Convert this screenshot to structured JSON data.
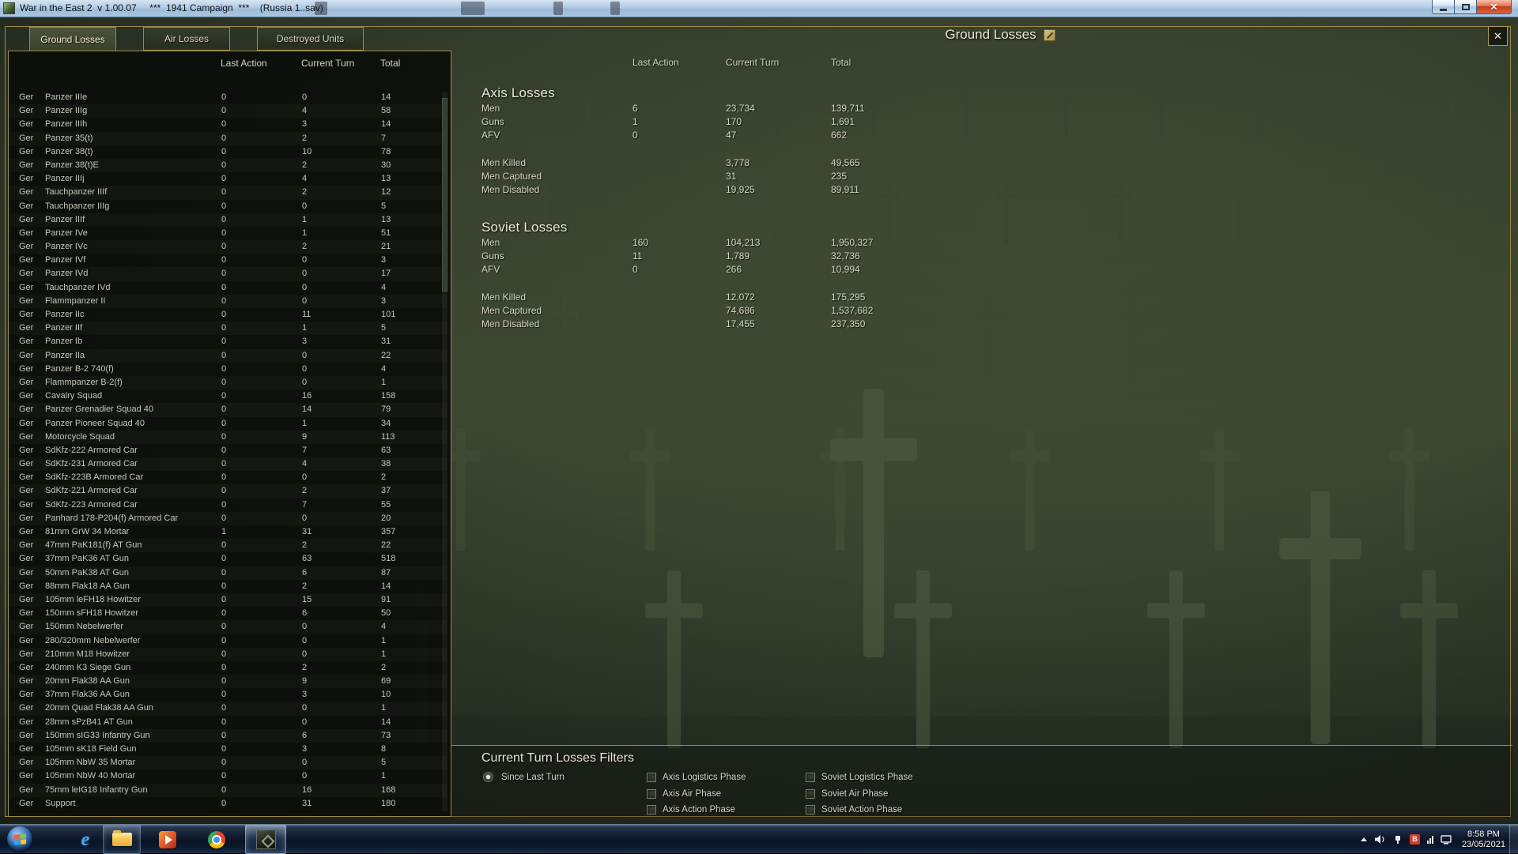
{
  "window": {
    "title": "War in the East 2  v 1.00.07     ***  1941 Campaign  ***    (Russia 1..sav)",
    "close_glyph": "✕"
  },
  "screen": {
    "title": "Ground Losses",
    "tabs": [
      {
        "label": "Ground Losses",
        "active": true
      },
      {
        "label": "Air Losses",
        "active": false
      },
      {
        "label": "Destroyed Units",
        "active": false
      }
    ]
  },
  "left_table": {
    "headers": {
      "last_action": "Last Action",
      "current_turn": "Current Turn",
      "total": "Total"
    },
    "rows": [
      {
        "nat": "Ger",
        "name": "Panzer IIIe",
        "last_action": "0",
        "current_turn": "0",
        "total": "14"
      },
      {
        "nat": "Ger",
        "name": "Panzer IIIg",
        "last_action": "0",
        "current_turn": "4",
        "total": "58"
      },
      {
        "nat": "Ger",
        "name": "Panzer IIIh",
        "last_action": "0",
        "current_turn": "3",
        "total": "14"
      },
      {
        "nat": "Ger",
        "name": "Panzer 35(t)",
        "last_action": "0",
        "current_turn": "2",
        "total": "7"
      },
      {
        "nat": "Ger",
        "name": "Panzer 38(t)",
        "last_action": "0",
        "current_turn": "10",
        "total": "78"
      },
      {
        "nat": "Ger",
        "name": "Panzer 38(t)E",
        "last_action": "0",
        "current_turn": "2",
        "total": "30"
      },
      {
        "nat": "Ger",
        "name": "Panzer IIIj",
        "last_action": "0",
        "current_turn": "4",
        "total": "13"
      },
      {
        "nat": "Ger",
        "name": "Tauchpanzer IIIf",
        "last_action": "0",
        "current_turn": "2",
        "total": "12"
      },
      {
        "nat": "Ger",
        "name": "Tauchpanzer IIIg",
        "last_action": "0",
        "current_turn": "0",
        "total": "5"
      },
      {
        "nat": "Ger",
        "name": "Panzer IIIf",
        "last_action": "0",
        "current_turn": "1",
        "total": "13"
      },
      {
        "nat": "Ger",
        "name": "Panzer IVe",
        "last_action": "0",
        "current_turn": "1",
        "total": "51"
      },
      {
        "nat": "Ger",
        "name": "Panzer IVc",
        "last_action": "0",
        "current_turn": "2",
        "total": "21"
      },
      {
        "nat": "Ger",
        "name": "Panzer IVf",
        "last_action": "0",
        "current_turn": "0",
        "total": "3"
      },
      {
        "nat": "Ger",
        "name": "Panzer IVd",
        "last_action": "0",
        "current_turn": "0",
        "total": "17"
      },
      {
        "nat": "Ger",
        "name": "Tauchpanzer IVd",
        "last_action": "0",
        "current_turn": "0",
        "total": "4"
      },
      {
        "nat": "Ger",
        "name": "Flammpanzer II",
        "last_action": "0",
        "current_turn": "0",
        "total": "3"
      },
      {
        "nat": "Ger",
        "name": "Panzer IIc",
        "last_action": "0",
        "current_turn": "11",
        "total": "101"
      },
      {
        "nat": "Ger",
        "name": "Panzer IIf",
        "last_action": "0",
        "current_turn": "1",
        "total": "5"
      },
      {
        "nat": "Ger",
        "name": "Panzer Ib",
        "last_action": "0",
        "current_turn": "3",
        "total": "31"
      },
      {
        "nat": "Ger",
        "name": "Panzer IIa",
        "last_action": "0",
        "current_turn": "0",
        "total": "22"
      },
      {
        "nat": "Ger",
        "name": "Panzer B-2 740(f)",
        "last_action": "0",
        "current_turn": "0",
        "total": "4"
      },
      {
        "nat": "Ger",
        "name": "Flammpanzer B-2(f)",
        "last_action": "0",
        "current_turn": "0",
        "total": "1"
      },
      {
        "nat": "Ger",
        "name": "Cavalry Squad",
        "last_action": "0",
        "current_turn": "16",
        "total": "158"
      },
      {
        "nat": "Ger",
        "name": "Panzer Grenadier Squad 40",
        "last_action": "0",
        "current_turn": "14",
        "total": "79"
      },
      {
        "nat": "Ger",
        "name": "Panzer Pioneer Squad 40",
        "last_action": "0",
        "current_turn": "1",
        "total": "34"
      },
      {
        "nat": "Ger",
        "name": "Motorcycle Squad",
        "last_action": "0",
        "current_turn": "9",
        "total": "113"
      },
      {
        "nat": "Ger",
        "name": "SdKfz-222 Armored Car",
        "last_action": "0",
        "current_turn": "7",
        "total": "63"
      },
      {
        "nat": "Ger",
        "name": "SdKfz-231 Armored Car",
        "last_action": "0",
        "current_turn": "4",
        "total": "38"
      },
      {
        "nat": "Ger",
        "name": "SdKfz-223B Armored Car",
        "last_action": "0",
        "current_turn": "0",
        "total": "2"
      },
      {
        "nat": "Ger",
        "name": "SdKfz-221 Armored Car",
        "last_action": "0",
        "current_turn": "2",
        "total": "37"
      },
      {
        "nat": "Ger",
        "name": "SdKfz-223 Armored Car",
        "last_action": "0",
        "current_turn": "7",
        "total": "55"
      },
      {
        "nat": "Ger",
        "name": "Panhard 178-P204(f) Armored Car",
        "last_action": "0",
        "current_turn": "0",
        "total": "20"
      },
      {
        "nat": "Ger",
        "name": "81mm GrW 34 Mortar",
        "last_action": "1",
        "current_turn": "31",
        "total": "357"
      },
      {
        "nat": "Ger",
        "name": "47mm PaK181(f) AT Gun",
        "last_action": "0",
        "current_turn": "2",
        "total": "22"
      },
      {
        "nat": "Ger",
        "name": "37mm PaK36 AT Gun",
        "last_action": "0",
        "current_turn": "63",
        "total": "518"
      },
      {
        "nat": "Ger",
        "name": "50mm PaK38 AT Gun",
        "last_action": "0",
        "current_turn": "6",
        "total": "87"
      },
      {
        "nat": "Ger",
        "name": "88mm Flak18 AA Gun",
        "last_action": "0",
        "current_turn": "2",
        "total": "14"
      },
      {
        "nat": "Ger",
        "name": "105mm leFH18 Howitzer",
        "last_action": "0",
        "current_turn": "15",
        "total": "91"
      },
      {
        "nat": "Ger",
        "name": "150mm sFH18 Howitzer",
        "last_action": "0",
        "current_turn": "6",
        "total": "50"
      },
      {
        "nat": "Ger",
        "name": "150mm Nebelwerfer",
        "last_action": "0",
        "current_turn": "0",
        "total": "4"
      },
      {
        "nat": "Ger",
        "name": "280/320mm Nebelwerfer",
        "last_action": "0",
        "current_turn": "0",
        "total": "1"
      },
      {
        "nat": "Ger",
        "name": "210mm M18 Howitzer",
        "last_action": "0",
        "current_turn": "0",
        "total": "1"
      },
      {
        "nat": "Ger",
        "name": "240mm K3 Siege Gun",
        "last_action": "0",
        "current_turn": "2",
        "total": "2"
      },
      {
        "nat": "Ger",
        "name": "20mm Flak38 AA Gun",
        "last_action": "0",
        "current_turn": "9",
        "total": "69"
      },
      {
        "nat": "Ger",
        "name": "37mm Flak36 AA Gun",
        "last_action": "0",
        "current_turn": "3",
        "total": "10"
      },
      {
        "nat": "Ger",
        "name": "20mm Quad Flak38 AA Gun",
        "last_action": "0",
        "current_turn": "0",
        "total": "1"
      },
      {
        "nat": "Ger",
        "name": "28mm sPzB41 AT Gun",
        "last_action": "0",
        "current_turn": "0",
        "total": "14"
      },
      {
        "nat": "Ger",
        "name": "150mm sIG33 Infantry Gun",
        "last_action": "0",
        "current_turn": "6",
        "total": "73"
      },
      {
        "nat": "Ger",
        "name": "105mm sK18 Field Gun",
        "last_action": "0",
        "current_turn": "3",
        "total": "8"
      },
      {
        "nat": "Ger",
        "name": "105mm NbW 35 Mortar",
        "last_action": "0",
        "current_turn": "0",
        "total": "5"
      },
      {
        "nat": "Ger",
        "name": "105mm NbW 40 Mortar",
        "last_action": "0",
        "current_turn": "0",
        "total": "1"
      },
      {
        "nat": "Ger",
        "name": "75mm leIG18 Infantry Gun",
        "last_action": "0",
        "current_turn": "16",
        "total": "168"
      },
      {
        "nat": "Ger",
        "name": "Support",
        "last_action": "0",
        "current_turn": "31",
        "total": "180"
      }
    ]
  },
  "summary": {
    "headers": {
      "last_action": "Last Action",
      "current_turn": "Current Turn",
      "total": "Total"
    },
    "axis": {
      "title": "Axis Losses",
      "rows": [
        {
          "label": "Men",
          "last_action": "6",
          "current_turn": "23,734",
          "total": "139,711"
        },
        {
          "label": "Guns",
          "last_action": "1",
          "current_turn": "170",
          "total": "1,691"
        },
        {
          "label": "AFV",
          "last_action": "0",
          "current_turn": "47",
          "total": "662"
        },
        {
          "label": "Men Killed",
          "last_action": "",
          "current_turn": "3,778",
          "total": "49,565",
          "gap": true
        },
        {
          "label": "Men Captured",
          "last_action": "",
          "current_turn": "31",
          "total": "235"
        },
        {
          "label": "Men Disabled",
          "last_action": "",
          "current_turn": "19,925",
          "total": "89,911"
        }
      ]
    },
    "soviet": {
      "title": "Soviet Losses",
      "rows": [
        {
          "label": "Men",
          "last_action": "160",
          "current_turn": "104,213",
          "total": "1,950,327"
        },
        {
          "label": "Guns",
          "last_action": "11",
          "current_turn": "1,789",
          "total": "32,736"
        },
        {
          "label": "AFV",
          "last_action": "0",
          "current_turn": "266",
          "total": "10,994"
        },
        {
          "label": "Men Killed",
          "last_action": "",
          "current_turn": "12,072",
          "total": "175,295",
          "gap": true
        },
        {
          "label": "Men Captured",
          "last_action": "",
          "current_turn": "74,686",
          "total": "1,537,682"
        },
        {
          "label": "Men Disabled",
          "last_action": "",
          "current_turn": "17,455",
          "total": "237,350"
        }
      ]
    }
  },
  "filters": {
    "title": "Current Turn Losses Filters",
    "radio": {
      "label": "Since Last Turn",
      "selected": true
    },
    "checkboxes": [
      {
        "label": "Axis Logistics Phase",
        "checked": false
      },
      {
        "label": "Axis Air Phase",
        "checked": false
      },
      {
        "label": "Axis Action Phase",
        "checked": false
      },
      {
        "label": "Soviet Logistics Phase",
        "checked": false
      },
      {
        "label": "Soviet Air Phase",
        "checked": false
      },
      {
        "label": "Soviet Action Phase",
        "checked": false
      }
    ]
  },
  "taskbar": {
    "apps": [
      "internet-explorer",
      "file-explorer",
      "media-player",
      "chrome",
      "war-in-the-east-2"
    ],
    "tray_icons": [
      "hidden-icons-chevron",
      "volume",
      "power",
      "security",
      "signal-bars",
      "network"
    ],
    "tray": {
      "time": "8:58 PM",
      "date": "23/05/2021"
    }
  },
  "colors": {
    "accent_gold": "#9f8a48",
    "background_olive": "#313a2c",
    "panel_background": "#0b100a",
    "text_light": "#d8d5c4"
  }
}
